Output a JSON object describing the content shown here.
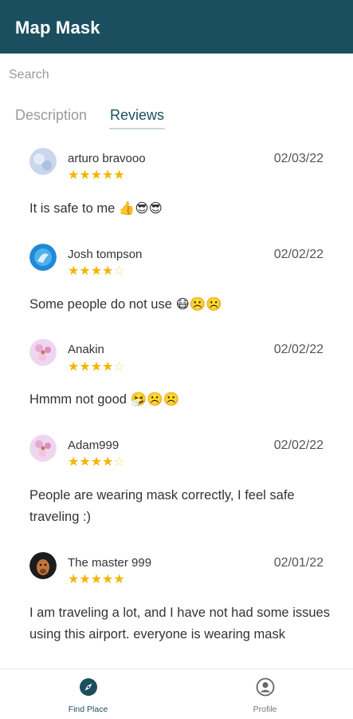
{
  "app": {
    "title": "Map Mask"
  },
  "search": {
    "placeholder": "Search",
    "value": ""
  },
  "tabs": [
    {
      "label": "Description",
      "active": false
    },
    {
      "label": "Reviews",
      "active": true
    }
  ],
  "reviews": [
    {
      "name": "arturo bravooo",
      "date": "02/03/22",
      "rating": 5,
      "text": "It is safe to me 👍😎😎",
      "avatar": "pale-blue-avatar"
    },
    {
      "name": "Josh tompson",
      "date": "02/02/22",
      "rating": 4,
      "text": "Some people do not use 😷☹️☹️",
      "avatar": "blue-dolphin-avatar"
    },
    {
      "name": "Anakin",
      "date": "02/02/22",
      "rating": 4,
      "text": "Hmmm not good 🤧☹️☹️",
      "avatar": "pink-flower-avatar"
    },
    {
      "name": "Adam999",
      "date": "02/02/22",
      "rating": 4,
      "text": "People are wearing mask correctly, I feel safe traveling :)",
      "avatar": "pink-flower-avatar"
    },
    {
      "name": "The master 999",
      "date": "02/01/22",
      "rating": 5,
      "text": "I am traveling a lot, and I have not had some issues using this airport. everyone is wearing mask",
      "avatar": "dog-avatar"
    }
  ],
  "nav": [
    {
      "label": "Find Place",
      "icon": "compass-icon",
      "active": true
    },
    {
      "label": "Profile",
      "icon": "user-circle-icon",
      "active": false
    }
  ],
  "colors": {
    "primary": "#1b4f5f",
    "star": "#f5b400"
  }
}
